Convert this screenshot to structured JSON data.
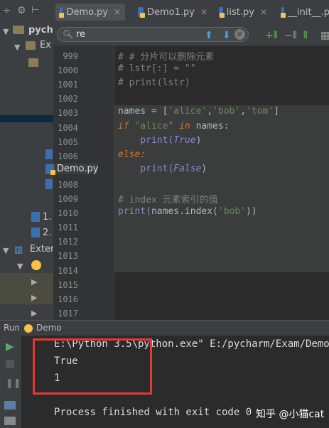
{
  "tabs": [
    {
      "label": "Demo.py",
      "active": true
    },
    {
      "label": "Demo1.py",
      "active": false
    },
    {
      "label": "list.py",
      "active": false
    },
    {
      "label": "__init__.p",
      "active": false
    }
  ],
  "project": {
    "root_label": "pych",
    "file_label": "Demo.py",
    "external_label": "Exter"
  },
  "search": {
    "value": "re"
  },
  "editor": {
    "line_numbers": [
      "999",
      "1000",
      "1001",
      "1002",
      "1003",
      "1004",
      "1005",
      "1006",
      "1007",
      "1008",
      "1009",
      "1010",
      "1011",
      "1012",
      "1013",
      "1014",
      "1015",
      "1016",
      "1017"
    ],
    "lines": [
      {
        "segments": [
          {
            "t": "# # 分片可以删除元素",
            "c": "cm"
          }
        ]
      },
      {
        "segments": [
          {
            "t": "# lstr[:] = \"\"",
            "c": "cm"
          }
        ]
      },
      {
        "segments": [
          {
            "t": "# print(lstr)",
            "c": "cm"
          }
        ]
      },
      {
        "segments": []
      },
      {
        "segments": [
          {
            "t": "names = [",
            "c": "fn"
          },
          {
            "t": "'alice'",
            "c": "st"
          },
          {
            "t": ",",
            "c": "fn"
          },
          {
            "t": "'bob'",
            "c": "st"
          },
          {
            "t": ",",
            "c": "fn"
          },
          {
            "t": "'tom'",
            "c": "st"
          },
          {
            "t": "]",
            "c": "fn"
          }
        ]
      },
      {
        "segments": [
          {
            "t": "if ",
            "c": "kw"
          },
          {
            "t": "\"alice\"",
            "c": "st"
          },
          {
            "t": " in ",
            "c": "kw"
          },
          {
            "t": "names:",
            "c": "fn"
          }
        ]
      },
      {
        "segments": [
          {
            "t": "    print(",
            "c": "bi"
          },
          {
            "t": "True",
            "c": "it"
          },
          {
            "t": ")",
            "c": "fn"
          }
        ]
      },
      {
        "segments": [
          {
            "t": "else:",
            "c": "kw"
          }
        ]
      },
      {
        "segments": [
          {
            "t": "    print(",
            "c": "bi"
          },
          {
            "t": "False",
            "c": "it"
          },
          {
            "t": ")",
            "c": "fn"
          }
        ]
      },
      {
        "segments": []
      },
      {
        "segments": [
          {
            "t": "# index 元素索引的值",
            "c": "cm"
          }
        ]
      },
      {
        "segments": [
          {
            "t": "print(",
            "c": "bi"
          },
          {
            "t": "names.index(",
            "c": "fn"
          },
          {
            "t": "'bob'",
            "c": "st"
          },
          {
            "t": "))",
            "c": "fn"
          }
        ]
      }
    ]
  },
  "run": {
    "title": "Run",
    "config": "Demo",
    "console": [
      "E:\\Python 3.5\\python.exe\" E:/pycharm/Exam/Demo",
      "True",
      "1",
      "",
      "Process finished with exit code 0"
    ]
  },
  "watermark": "知乎 @小猫cat",
  "colors": {
    "accent": "#4a9ee8",
    "highlight": "#e53935"
  }
}
